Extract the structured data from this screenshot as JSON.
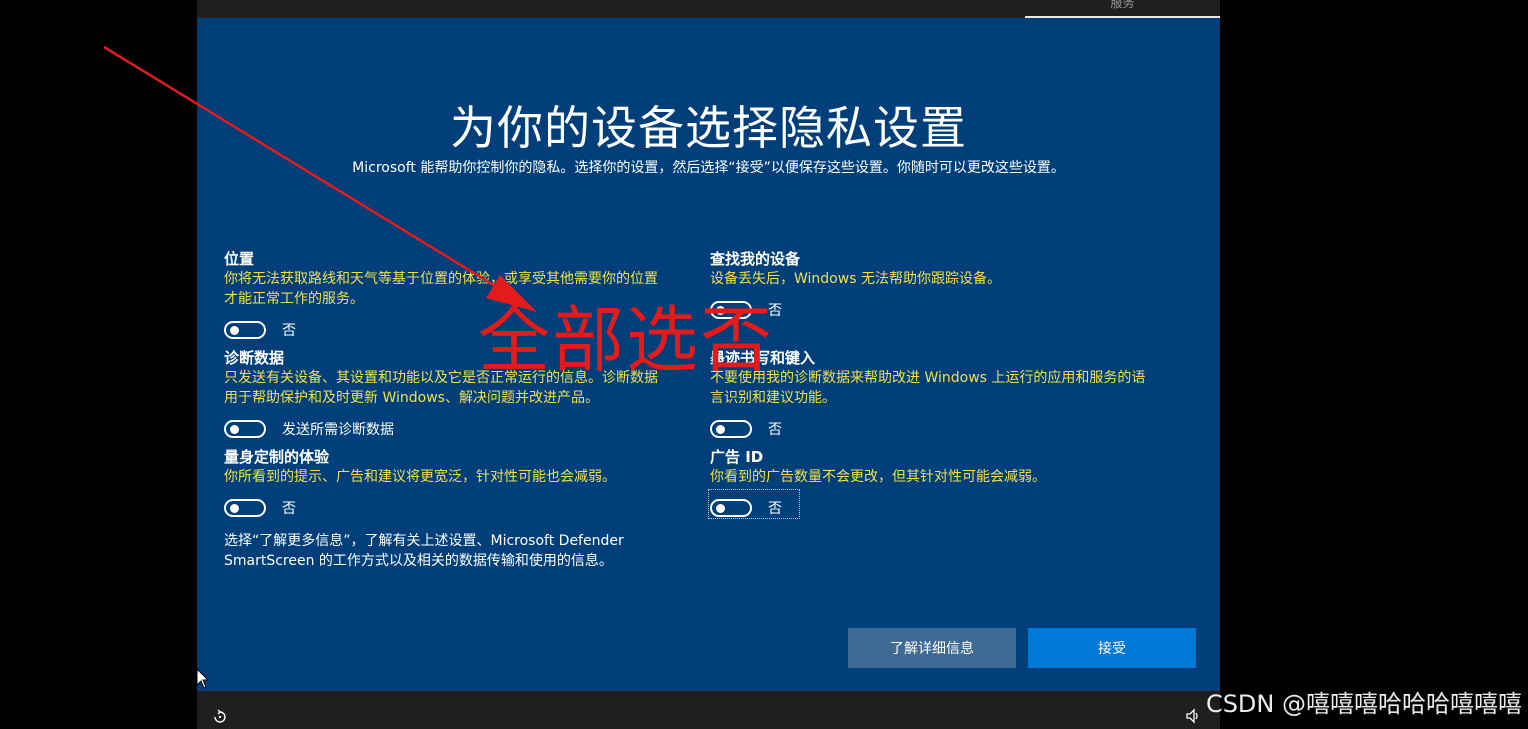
{
  "header": {
    "tab_label": "服务"
  },
  "main": {
    "title": "为你的设备选择隐私设置",
    "subtitle": "Microsoft 能帮助你控制你的隐私。选择你的设置，然后选择“接受”以便保存这些设置。你随时可以更改这些设置。"
  },
  "settings": {
    "location": {
      "title": "位置",
      "desc_line1": "你将无法获取路线和天气等基于位置的体验，或享受其他需要你的位置",
      "desc_line2": "才能正常工作的服务。",
      "toggle_label": "否"
    },
    "find_device": {
      "title": "查找我的设备",
      "desc_line1": "设备丢失后，Windows 无法帮助你跟踪设备。",
      "toggle_label": "否"
    },
    "diagnostics": {
      "title": "诊断数据",
      "desc_line1": "只发送有关设备、其设置和功能以及它是否正常运行的信息。诊断数据",
      "desc_line2": "用于帮助保护和及时更新 Windows、解决问题并改进产品。",
      "toggle_label": "发送所需诊断数据"
    },
    "inking": {
      "title": "墨迹书写和键入",
      "desc_line1": "不要使用我的诊断数据来帮助改进 Windows 上运行的应用和服务的语",
      "desc_line2": "言识别和建议功能。",
      "toggle_label": "否"
    },
    "tailored": {
      "title": "量身定制的体验",
      "desc_line1": "你所看到的提示、广告和建议将更宽泛，针对性可能也会减弱。",
      "toggle_label": "否"
    },
    "ad_id": {
      "title": "广告 ID",
      "desc_line1": "你看到的广告数量不会更改，但其针对性可能会减弱。",
      "toggle_label": "否"
    }
  },
  "info": {
    "line1": "选择“了解更多信息”，了解有关上述设置、Microsoft Defender",
    "line2": "SmartScreen 的工作方式以及相关的数据传输和使用的信息。"
  },
  "buttons": {
    "learn_more": "了解详细信息",
    "accept": "接受"
  },
  "annotation": {
    "text": "全部选否",
    "color": "#e21b1b"
  },
  "watermark": {
    "text": "CSDN @嘻嘻嘻哈哈哈嘻嘻嘻"
  },
  "colors": {
    "panel": "#003f7a",
    "accent": "#0078d7",
    "description": "#f2e04a"
  },
  "icons": {
    "ease_of_access": "ease-of-access-icon",
    "volume": "volume-icon",
    "cursor": "mouse-cursor-icon"
  }
}
